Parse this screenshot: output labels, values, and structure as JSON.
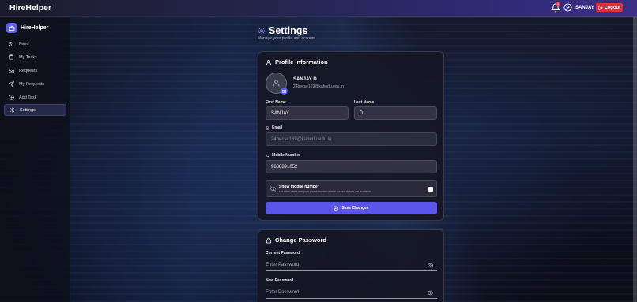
{
  "topbar": {
    "brand": "HireHelper",
    "notification_count": "1",
    "username": "SANJAY",
    "logout_label": "Logout"
  },
  "sidebar": {
    "brand": "HireHelper",
    "items": [
      {
        "label": "Feed",
        "icon": "feed-icon"
      },
      {
        "label": "My Tasks",
        "icon": "tasks-icon"
      },
      {
        "label": "Requests",
        "icon": "inbox-icon"
      },
      {
        "label": "My Requests",
        "icon": "send-icon"
      },
      {
        "label": "Add Task",
        "icon": "plus-circle-icon"
      },
      {
        "label": "Settings",
        "icon": "gear-icon",
        "active": true
      }
    ]
  },
  "page": {
    "title": "Settings",
    "subtitle": "Manage your profile and account"
  },
  "profile": {
    "section_title": "Profile Information",
    "name": "SANJAY D",
    "email": "24becse169@kahedu.edu.in",
    "first_name_label": "First Name",
    "first_name_value": "SANJAY",
    "last_name_label": "Last Name",
    "last_name_value": "D",
    "email_label": "Email",
    "email_value": "24becse169@kahedu.edu.in",
    "mobile_label": "Mobile Number",
    "mobile_value": "9688891052",
    "show_mobile_title": "Show mobile number",
    "show_mobile_desc": "Let other users see your phone number where contact details are available.",
    "show_mobile_checked": true,
    "save_label": "Save Changes"
  },
  "password": {
    "section_title": "Change Password",
    "current_label": "Current Password",
    "current_placeholder": "Enter Password",
    "new_label": "New Password",
    "new_placeholder": "Enter Password"
  },
  "colors": {
    "accent": "#5a55e8",
    "logout": "#d9303e",
    "badge": "#e23b4a"
  }
}
